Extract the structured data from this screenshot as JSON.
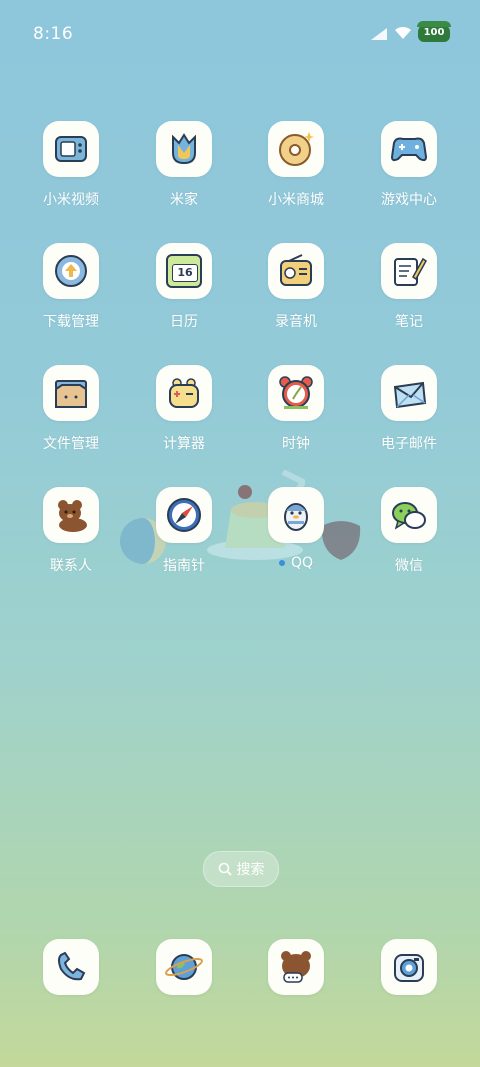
{
  "status_bar": {
    "time": "8:16",
    "battery": "100"
  },
  "apps": [
    {
      "label": "小米视频",
      "icon": "tv-cat-icon"
    },
    {
      "label": "米家",
      "icon": "tulip-icon"
    },
    {
      "label": "小米商城",
      "icon": "donut-icon"
    },
    {
      "label": "游戏中心",
      "icon": "gamepad-icon"
    },
    {
      "label": "下载管理",
      "icon": "download-circle-icon"
    },
    {
      "label": "日历",
      "icon": "calendar-icon",
      "day": "16"
    },
    {
      "label": "录音机",
      "icon": "radio-icon"
    },
    {
      "label": "笔记",
      "icon": "notepad-pencil-icon"
    },
    {
      "label": "文件管理",
      "icon": "folder-cat-icon"
    },
    {
      "label": "计算器",
      "icon": "calculator-frog-icon"
    },
    {
      "label": "时钟",
      "icon": "alarm-clock-icon"
    },
    {
      "label": "电子邮件",
      "icon": "envelope-icon"
    },
    {
      "label": "联系人",
      "icon": "bear-icon"
    },
    {
      "label": "指南针",
      "icon": "compass-icon"
    },
    {
      "label": "QQ",
      "icon": "penguin-icon",
      "has_notification_dot": true
    },
    {
      "label": "微信",
      "icon": "chat-bubbles-icon"
    }
  ],
  "search": {
    "label": "搜索"
  },
  "dock": [
    {
      "icon": "phone-icon"
    },
    {
      "icon": "planet-icon"
    },
    {
      "icon": "bear-message-icon"
    },
    {
      "icon": "camera-icon"
    }
  ],
  "colors": {
    "label": "#ffffff",
    "tile": "#fefef8",
    "battery": "#2f7a3a",
    "notification_dot": "#3a8fd8"
  }
}
